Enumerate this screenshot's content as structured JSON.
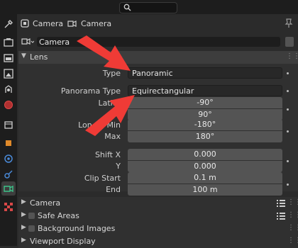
{
  "header": {
    "search": {
      "icon": "search-icon"
    },
    "breadcrumb": [
      "Camera",
      "Camera"
    ],
    "pin_icon": "pin-icon"
  },
  "datablock": {
    "name": "Camera",
    "icon": "camera-data-icon",
    "fake_user_icon": "shield-icon"
  },
  "sections": {
    "lens": "Lens",
    "camera": "Camera",
    "safe_areas": "Safe Areas",
    "background_images": "Background Images",
    "viewport_display": "Viewport Display"
  },
  "lens": {
    "type_label": "Type",
    "type_value": "Panoramic",
    "panorama_type_label": "Panorama Type",
    "panorama_type_value": "Equirectangular",
    "latitude_label": "Latitu",
    "latitude_min": "-90°",
    "latitude_max": "90°",
    "longitude_min_label": "Lon       de Min",
    "longitude_min": "-180°",
    "max_label": "Max",
    "longitude_max": "180°",
    "shift_x_label": "Shift X",
    "shift_x": "0.000",
    "shift_y_label": "Y",
    "shift_y": "0.000",
    "clip_start_label": "Clip Start",
    "clip_start": "0.1 m",
    "clip_end_label": "End",
    "clip_end": "100 m"
  },
  "colors": {
    "annotation_arrow": "#ef3b36",
    "panel_bg": "#303030",
    "field": "#545454"
  }
}
